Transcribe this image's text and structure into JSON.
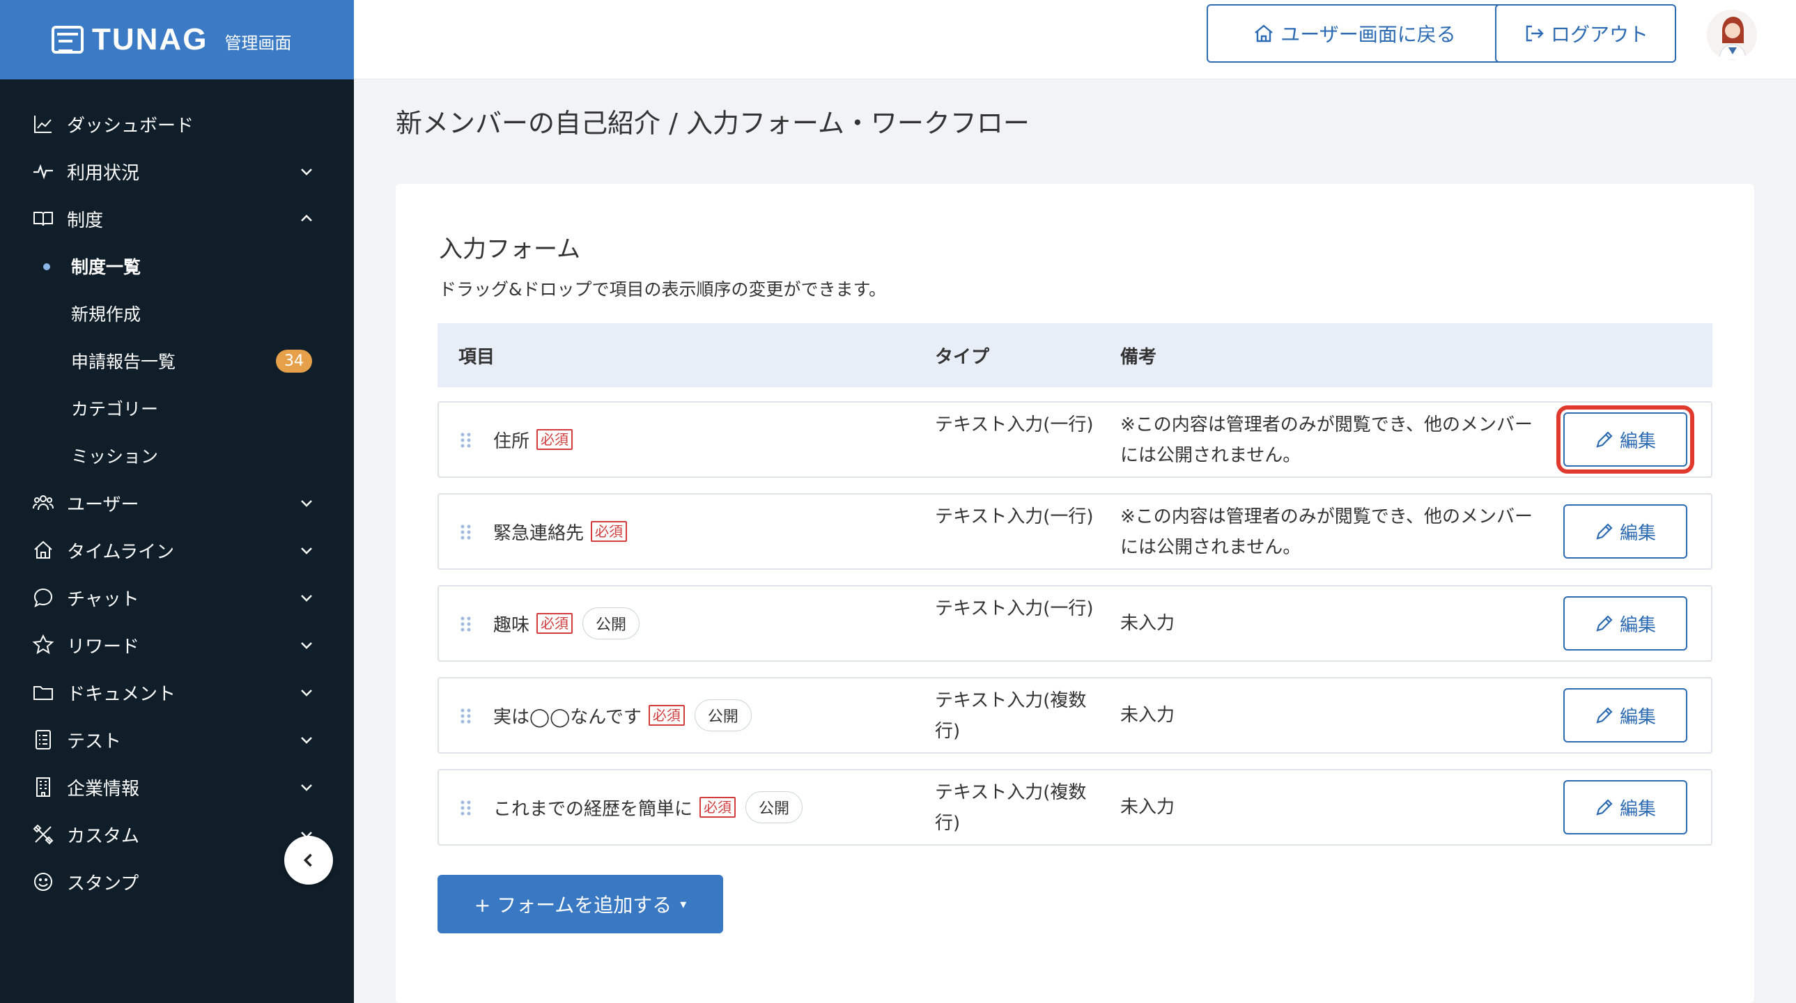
{
  "brand": {
    "name": "TUNAG",
    "sub": "管理画面"
  },
  "sidebar": {
    "items": [
      {
        "label": "ダッシュボード",
        "icon": "chart-icon"
      },
      {
        "label": "利用状況",
        "icon": "pulse-icon"
      },
      {
        "label": "制度",
        "icon": "book-icon"
      },
      {
        "label": "ユーザー",
        "icon": "users-icon"
      },
      {
        "label": "タイムライン",
        "icon": "home-icon"
      },
      {
        "label": "チャット",
        "icon": "chat-icon"
      },
      {
        "label": "リワード",
        "icon": "star-icon"
      },
      {
        "label": "ドキュメント",
        "icon": "folder-icon"
      },
      {
        "label": "テスト",
        "icon": "test-icon"
      },
      {
        "label": "企業情報",
        "icon": "building-icon"
      },
      {
        "label": "カスタム",
        "icon": "tools-icon"
      },
      {
        "label": "スタンプ",
        "icon": "smile-icon"
      }
    ],
    "sub_items": [
      {
        "label": "制度一覧"
      },
      {
        "label": "新規作成"
      },
      {
        "label": "申請報告一覧",
        "badge": "34"
      },
      {
        "label": "カテゴリー"
      },
      {
        "label": "ミッション"
      }
    ]
  },
  "header": {
    "home_label": "ユーザー画面に戻る",
    "logout_label": "ログアウト"
  },
  "page": {
    "title": "新メンバーの自己紹介 / 入力フォーム・ワークフロー",
    "section_title": "入力フォーム",
    "section_desc": "ドラッグ&ドロップで項目の表示順序の変更ができます。",
    "columns": {
      "item": "項目",
      "type": "タイプ",
      "note": "備考"
    },
    "required_label": "必須",
    "public_label": "公開",
    "edit_label": "編集",
    "rows": [
      {
        "name": "住所",
        "type": "テキスト入力(一行)",
        "note": "※この内容は管理者のみが閲覧でき、他のメンバーには公開されません。"
      },
      {
        "name": "緊急連絡先",
        "type": "テキスト入力(一行)",
        "note": "※この内容は管理者のみが閲覧でき、他のメンバーには公開されません。"
      },
      {
        "name": "趣味",
        "type": "テキスト入力(一行)",
        "note": "未入力"
      },
      {
        "name": "実は◯◯なんです",
        "type": "テキスト入力(複数行)",
        "note": "未入力"
      },
      {
        "name": "これまでの経歴を簡単に",
        "type": "テキスト入力(複数行)",
        "note": "未入力"
      }
    ],
    "add_button_label": "+ フォームを追加する",
    "add_button_caret": "▾"
  },
  "colors": {
    "sidebar_bg": "#0f1e28",
    "brand_bg": "#3b7bc6",
    "accent": "#2c6bb3",
    "required": "#d23c3c",
    "badge": "#e6a04a",
    "highlight": "#e03a2e"
  }
}
